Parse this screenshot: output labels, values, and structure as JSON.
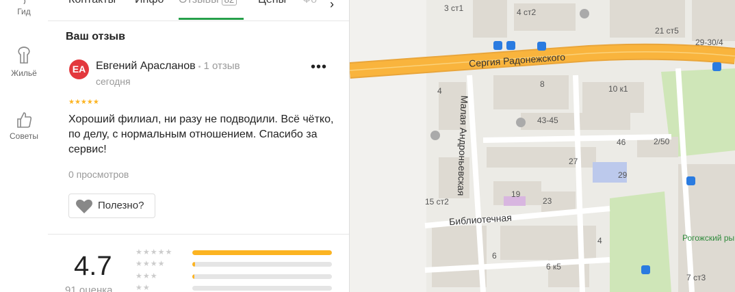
{
  "nav": [
    {
      "label": "Гид",
      "icon": "guide-icon"
    },
    {
      "label": "Жильё",
      "icon": "housing-icon"
    },
    {
      "label": "Советы",
      "icon": "thumbs-up-icon"
    }
  ],
  "tabs": [
    {
      "label": "Контакты"
    },
    {
      "label": "Инфо"
    },
    {
      "label": "Отзывы",
      "badge": "82",
      "active": true
    },
    {
      "label": "Цены"
    },
    {
      "label": "Фо"
    }
  ],
  "review": {
    "section_title": "Ваш отзыв",
    "avatar_initials": "ЕА",
    "author": "Евгений Арасланов",
    "author_reviews": "1 отзыв",
    "date": "сегодня",
    "stars": "★★★★★",
    "text": "Хороший филиал, ни разу не подводили. Всё чётко, по делу, с нормальным отношением. Спасибо за сервис!",
    "views": "0 просмотров",
    "useful_label": "Полезно?"
  },
  "rating": {
    "value": "4.7",
    "count_label": "91 оценка",
    "distribution": [
      {
        "stars": "★★★★★",
        "share": 1.0
      },
      {
        "stars": "★★★★",
        "share": 0.02
      },
      {
        "stars": "★★★",
        "share": 0.015
      },
      {
        "stars": "★★",
        "share": 0.0
      }
    ]
  },
  "map": {
    "streets": {
      "radonezhsky": "Сергия Радонежского",
      "andronyevskaya": "Малая Андроньевская",
      "bibliotechnaya": "Библиотечная"
    },
    "park": "Рогожский ры",
    "buildings": [
      "3 ст1",
      "4 ст2",
      "21 ст5",
      "29-30/4",
      "8",
      "10 к1",
      "4",
      "43-45",
      "46",
      "2/50",
      "27",
      "29",
      "19",
      "23",
      "15 ст2",
      "4",
      "6",
      "6 к5",
      "7 ст3"
    ]
  },
  "colors": {
    "accent": "#26a04a",
    "star": "#fcb422",
    "avatar": "#e3383d",
    "road": "#f9b43d"
  }
}
